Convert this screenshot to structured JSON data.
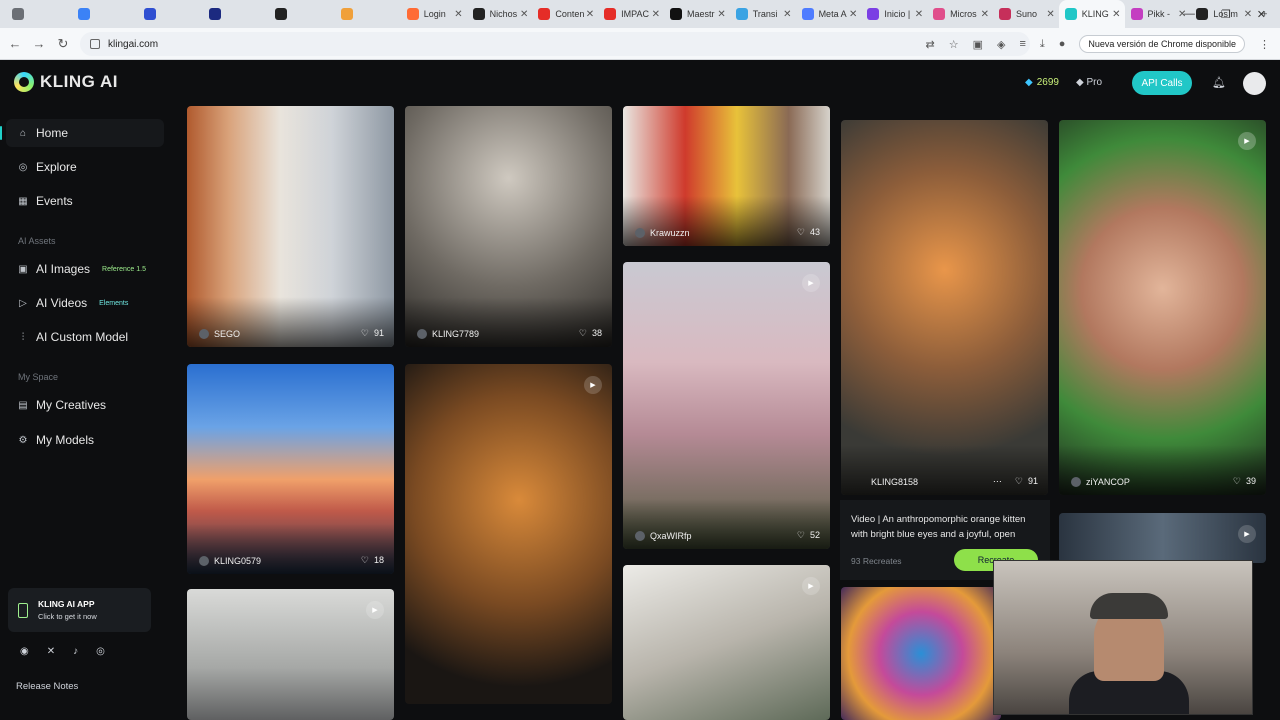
{
  "browser": {
    "tabs": [
      {
        "label": "",
        "color": "#6b6f75"
      },
      {
        "label": "",
        "color": "#3b82f6"
      },
      {
        "label": "",
        "color": "#2f4fd1"
      },
      {
        "label": "",
        "color": "#1c2a80"
      },
      {
        "label": "",
        "color": "#222"
      },
      {
        "label": "",
        "color": "#f0a03a"
      },
      {
        "label": "Login",
        "color": "#ff6b35"
      },
      {
        "label": "Nichos",
        "color": "#222"
      },
      {
        "label": "Conten",
        "color": "#e52d27"
      },
      {
        "label": "IMPAC",
        "color": "#e52d27"
      },
      {
        "label": "Maestr",
        "color": "#111"
      },
      {
        "label": "Transi",
        "color": "#3aa3e3"
      },
      {
        "label": "Meta A",
        "color": "#4f7cff"
      },
      {
        "label": "Inicio |",
        "color": "#7b3fe4"
      },
      {
        "label": "Micros",
        "color": "#e04e8b"
      },
      {
        "label": "Suno",
        "color": "#c62f5a"
      },
      {
        "label": "KLING",
        "color": "#21c7c7"
      },
      {
        "label": "Pikk -",
        "color": "#c43ec1"
      },
      {
        "label": "Los m",
        "color": "#222"
      }
    ],
    "active_tab_index": 16,
    "url": "klingai.com",
    "update_label": "Nueva versión de Chrome disponible"
  },
  "header": {
    "brand": "KLING AI",
    "credits": "2699",
    "plan": "Pro",
    "api_button": "API Calls"
  },
  "sidebar": {
    "home": "Home",
    "explore": "Explore",
    "events": "Events",
    "assets_section": "AI Assets",
    "ai_images": "AI Images",
    "ai_images_badge": "Reference 1.5",
    "ai_videos": "AI Videos",
    "ai_videos_badge": "Elements",
    "custom_model": "AI Custom Model",
    "space_section": "My Space",
    "creatives": "My Creatives",
    "models": "My Models",
    "app_title": "KLING AI APP",
    "app_sub": "Click to get it now",
    "release_notes": "Release Notes"
  },
  "gallery": {
    "cards": [
      {
        "owner": "SEGO",
        "likes": "91"
      },
      {
        "owner": "KLING7789",
        "likes": "38"
      },
      {
        "owner": "Krawuzzn",
        "likes": "43"
      },
      {
        "owner": "KLING8158",
        "likes": "91"
      },
      {
        "owner": "ziYANCOP",
        "likes": "39"
      },
      {
        "owner": "KLING0579",
        "likes": "18"
      },
      {
        "owner": "QxaWIRfp",
        "likes": "52"
      }
    ],
    "hover": {
      "text": "Video | An anthropomorphic orange kitten with bright blue eyes and a joyful, open",
      "recreates": "93 Recreates",
      "recreate_button": "Recreate"
    }
  }
}
